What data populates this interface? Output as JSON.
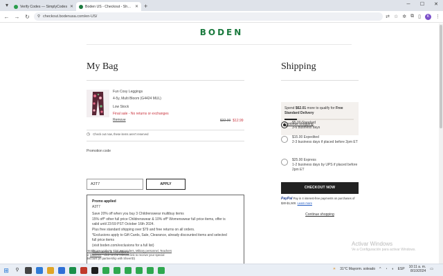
{
  "browser": {
    "tabs": [
      {
        "title": "Verify Codes — SimplyCodes",
        "active": false,
        "favicon_color": "#2a9d4b"
      },
      {
        "title": "Boden US - Checkout - Shoppi",
        "active": true,
        "favicon_color": "#1b7a3e"
      }
    ],
    "url": "checkout.bodenusa.com/en-US/",
    "new_tab": "+",
    "avatar_letter": "K"
  },
  "site": {
    "logo": "BODEN"
  },
  "bag": {
    "title": "My Bag",
    "item": {
      "name": "Fun Cosy Leggings",
      "variant": "4-5y, Multi Bloom (G4424 MUL)",
      "stock": "Low Stock",
      "final_sale": "Final sale - No returns or exchanges",
      "remove": "Remove",
      "old_price": "$32.00",
      "new_price": "$12.99"
    },
    "reserve_note": "Check out now, these items aren't reserved"
  },
  "promo": {
    "label": "Promotion code",
    "value": "A3T7",
    "apply": "APPLY",
    "applied_title": "Promo applied",
    "applied_code": "A3T7",
    "lines": [
      "Save 20% off when you buy 3 Childrenswear multibuy items",
      "15% off* other full price Childrenswear & 10% off* Womenswear full price items, offer is",
      "valid until 23:59 PST October 16th 2024.",
      "Plus free standard shipping over $79 and free returns on all orders.",
      "*Exclusions apply to Gift Cards, Sale, Clearance, already discounted items and selected",
      "full price items",
      "(visit boden.com/exclusions for a full list)"
    ],
    "terms_link": "View terms & conditions"
  },
  "footer_note": {
    "links": "Healthcare workers, First responders, Military personnel, Teachers",
    "line2_pre": "or ",
    "line2_link": "Students",
    "line2_post": " - click on the relevant link to receive your special",
    "line3": "discount (in partnership with SheerID)"
  },
  "shipping": {
    "title": "Shipping",
    "banner_pre": "Spend ",
    "banner_amount": "$62.01",
    "banner_mid": " more to qualify for ",
    "banner_bold": "Free Standard Delivery",
    "continue_link": "Continue shopping",
    "progress": 0.18,
    "options": [
      {
        "price": "$5.00 Standard",
        "desc": "3-6 business days",
        "selected": true
      },
      {
        "price": "$15.00 Expedited",
        "desc": "2-3 business days if placed before 2pm ET",
        "selected": false
      },
      {
        "price": "$25.00 Express",
        "desc": "1-2 business days by UPS if placed before 2pm ET",
        "selected": false
      }
    ],
    "checkout_button": "CHECKOUT NOW",
    "paypal_brand": "PayPal",
    "paypal_text": "Pay in 4 interest-free payments on purchases of $30-$1,500.",
    "paypal_link": "Learn more",
    "continue_bottom": "Continue shopping"
  },
  "watermark": {
    "title": "Activar Windows",
    "sub": "Ve a Configuración para activar Windows."
  },
  "taskbar": {
    "weather": "31°C  Mayorm. soleado",
    "lang": "ESP",
    "time": "10:11 a. m.",
    "date": "8/10/2024"
  }
}
